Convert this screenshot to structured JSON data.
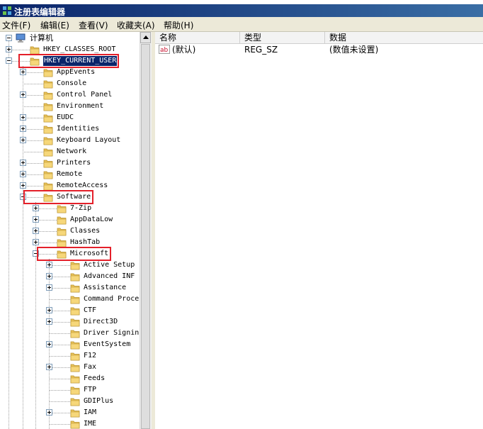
{
  "window": {
    "title": "注册表编辑器"
  },
  "menubar": [
    {
      "label": "文件(F)"
    },
    {
      "label": "编辑(E)"
    },
    {
      "label": "查看(V)"
    },
    {
      "label": "收藏夹(A)"
    },
    {
      "label": "帮助(H)"
    }
  ],
  "tree": {
    "root": {
      "label": "计算机",
      "icon": "computer-icon"
    },
    "nodes": [
      {
        "label": "HKEY_CLASSES_ROOT",
        "level": 1,
        "expander": "plus"
      },
      {
        "label": "HKEY_CURRENT_USER",
        "level": 1,
        "expander": "minus",
        "selected": true,
        "highlight": true
      },
      {
        "label": "AppEvents",
        "level": 2,
        "expander": "plus"
      },
      {
        "label": "Console",
        "level": 2,
        "expander": "none"
      },
      {
        "label": "Control Panel",
        "level": 2,
        "expander": "plus"
      },
      {
        "label": "Environment",
        "level": 2,
        "expander": "none"
      },
      {
        "label": "EUDC",
        "level": 2,
        "expander": "plus"
      },
      {
        "label": "Identities",
        "level": 2,
        "expander": "plus"
      },
      {
        "label": "Keyboard Layout",
        "level": 2,
        "expander": "plus"
      },
      {
        "label": "Network",
        "level": 2,
        "expander": "none"
      },
      {
        "label": "Printers",
        "level": 2,
        "expander": "plus"
      },
      {
        "label": "Remote",
        "level": 2,
        "expander": "plus"
      },
      {
        "label": "RemoteAccess",
        "level": 2,
        "expander": "plus"
      },
      {
        "label": "Software",
        "level": 2,
        "expander": "minus",
        "highlight": true
      },
      {
        "label": "7-Zip",
        "level": 3,
        "expander": "plus"
      },
      {
        "label": "AppDataLow",
        "level": 3,
        "expander": "plus"
      },
      {
        "label": "Classes",
        "level": 3,
        "expander": "plus"
      },
      {
        "label": "HashTab",
        "level": 3,
        "expander": "plus"
      },
      {
        "label": "Microsoft",
        "level": 3,
        "expander": "minus",
        "highlight": true
      },
      {
        "label": "Active Setup",
        "level": 4,
        "expander": "plus"
      },
      {
        "label": "Advanced INF",
        "level": 4,
        "expander": "plus"
      },
      {
        "label": "Assistance",
        "level": 4,
        "expander": "plus"
      },
      {
        "label": "Command Proce",
        "level": 4,
        "expander": "none"
      },
      {
        "label": "CTF",
        "level": 4,
        "expander": "plus"
      },
      {
        "label": "Direct3D",
        "level": 4,
        "expander": "plus"
      },
      {
        "label": "Driver Signin",
        "level": 4,
        "expander": "none"
      },
      {
        "label": "EventSystem",
        "level": 4,
        "expander": "plus"
      },
      {
        "label": "F12",
        "level": 4,
        "expander": "none"
      },
      {
        "label": "Fax",
        "level": 4,
        "expander": "plus"
      },
      {
        "label": "Feeds",
        "level": 4,
        "expander": "none"
      },
      {
        "label": "FTP",
        "level": 4,
        "expander": "none"
      },
      {
        "label": "GDIPlus",
        "level": 4,
        "expander": "none"
      },
      {
        "label": "IAM",
        "level": 4,
        "expander": "plus"
      },
      {
        "label": "IME",
        "level": 4,
        "expander": "none"
      }
    ]
  },
  "list": {
    "columns": [
      {
        "label": "名称"
      },
      {
        "label": "类型"
      },
      {
        "label": "数据"
      }
    ],
    "rows": [
      {
        "icon": "string-value-icon",
        "name": "(默认)",
        "type": "REG_SZ",
        "data": "(数值未设置)"
      }
    ]
  },
  "colors": {
    "titlebar": "#0a246a",
    "selection": "#0a246a",
    "highlight_box": "#e4202a",
    "folder": "#e8c25a"
  }
}
